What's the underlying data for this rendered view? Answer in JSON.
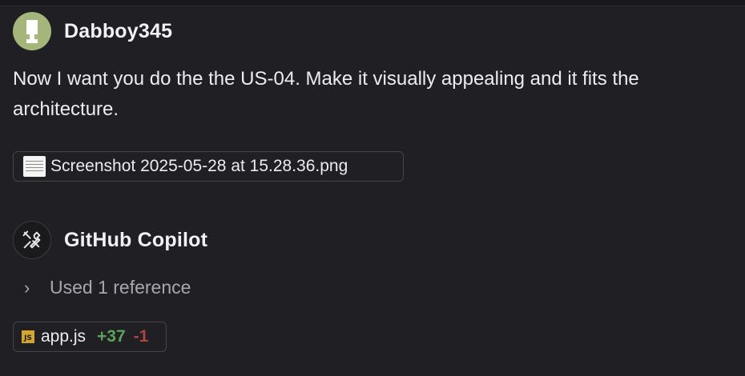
{
  "user_message": {
    "author": "Dabboy345",
    "text": "Now I want you do the the US-04. Make it visually appealing and it fits the architecture.",
    "attachment": {
      "icon": "image-thumbnail-icon",
      "filename": "Screenshot 2025-05-28 at 15.28.36.png"
    }
  },
  "assistant_message": {
    "author": "GitHub Copilot",
    "references_label": "Used 1 reference",
    "file_change": {
      "icon": "js-file-icon",
      "filename": "app.js",
      "additions": "+37",
      "deletions": "-1"
    }
  },
  "colors": {
    "background": "#1f1f24",
    "user_avatar": "#a5b67a",
    "additions": "#5aa35a",
    "deletions": "#b0443e"
  }
}
